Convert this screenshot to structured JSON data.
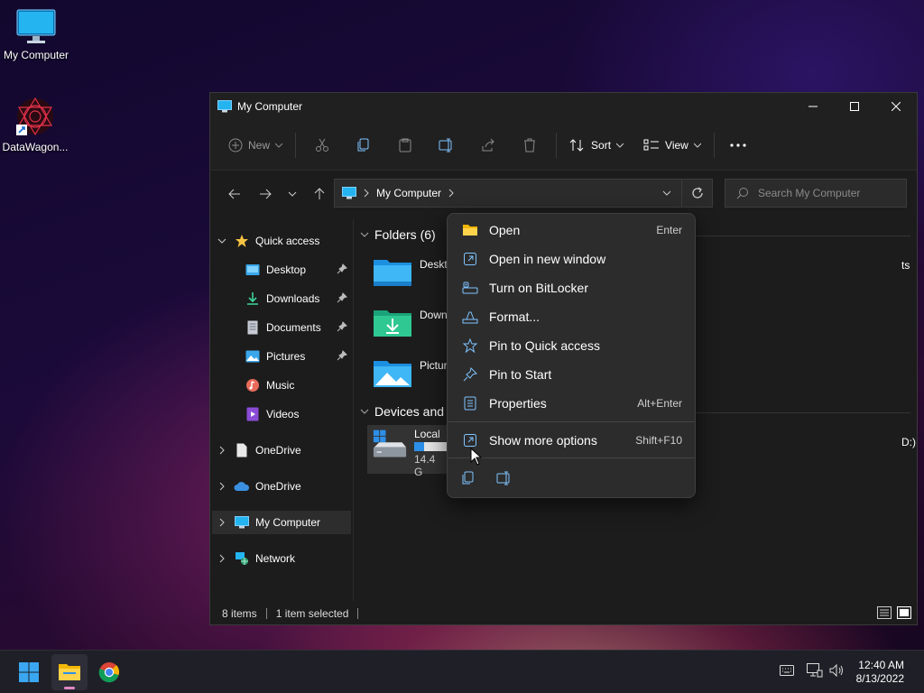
{
  "desktop": {
    "icons": [
      {
        "label": "My Computer",
        "icon": "monitor-icon"
      },
      {
        "label": "DataWagon...",
        "icon": "datawagon-icon"
      }
    ]
  },
  "window": {
    "title": "My Computer",
    "controls": [
      "minimize-icon",
      "maximize-icon",
      "close-icon"
    ]
  },
  "toolbar": {
    "new_label": "New",
    "sort_label": "Sort",
    "view_label": "View",
    "icons": [
      "cut-icon",
      "copy-icon",
      "paste-icon",
      "rename-icon",
      "share-icon",
      "delete-icon",
      "more-icon"
    ]
  },
  "address": {
    "path": "My Computer",
    "search_placeholder": "Search My Computer"
  },
  "sidebar": {
    "items": [
      {
        "label": "Quick access",
        "icon": "star-icon"
      },
      {
        "label": "Desktop",
        "icon": "desktop-folder-icon",
        "pinned": true
      },
      {
        "label": "Downloads",
        "icon": "download-icon",
        "pinned": true
      },
      {
        "label": "Documents",
        "icon": "document-icon",
        "pinned": true
      },
      {
        "label": "Pictures",
        "icon": "pictures-icon",
        "pinned": true
      },
      {
        "label": "Music",
        "icon": "music-icon"
      },
      {
        "label": "Videos",
        "icon": "video-icon"
      },
      {
        "label": "OneDrive",
        "icon": "file-icon"
      },
      {
        "label": "OneDrive",
        "icon": "cloud-icon"
      },
      {
        "label": "My Computer",
        "icon": "monitor-icon",
        "selected": true
      },
      {
        "label": "Network",
        "icon": "network-icon"
      }
    ]
  },
  "content": {
    "folders_header": "Folders (6)",
    "folders": [
      {
        "label": "Deskto",
        "icon": "desktop-folder-icon"
      },
      {
        "label": "Down",
        "icon": "downloads-folder-icon"
      },
      {
        "label": "Pictur",
        "icon": "pictures-folder-icon"
      }
    ],
    "folder_right_fragment": "ts",
    "devices_header": "Devices and",
    "drive": {
      "label": "Local",
      "size": "14.4 G",
      "used_fraction": 0.3
    },
    "drive_right_fragment": "D:)"
  },
  "statusbar": {
    "items_count": "8 items",
    "selected": "1 item selected"
  },
  "context_menu": {
    "items": [
      {
        "label": "Open",
        "shortcut": "Enter",
        "icon": "folder-open-icon"
      },
      {
        "label": "Open in new window",
        "shortcut": "",
        "icon": "new-window-icon"
      },
      {
        "label": "Turn on BitLocker",
        "shortcut": "",
        "icon": "bitlocker-icon"
      },
      {
        "label": "Format...",
        "shortcut": "",
        "icon": "format-icon"
      },
      {
        "label": "Pin to Quick access",
        "shortcut": "",
        "icon": "star-icon"
      },
      {
        "label": "Pin to Start",
        "shortcut": "",
        "icon": "pin-icon"
      },
      {
        "label": "Properties",
        "shortcut": "Alt+Enter",
        "icon": "properties-icon"
      },
      {
        "label": "Show more options",
        "shortcut": "Shift+F10",
        "icon": "more-options-icon"
      }
    ],
    "bottom_icons": [
      "copy-icon",
      "rename-icon"
    ]
  },
  "taskbar": {
    "apps": [
      "start-icon",
      "file-explorer-icon",
      "chrome-icon"
    ],
    "tray": [
      "keyboard-icon",
      "network-icon",
      "volume-icon"
    ],
    "time": "12:40 AM",
    "date": "8/13/2022"
  }
}
